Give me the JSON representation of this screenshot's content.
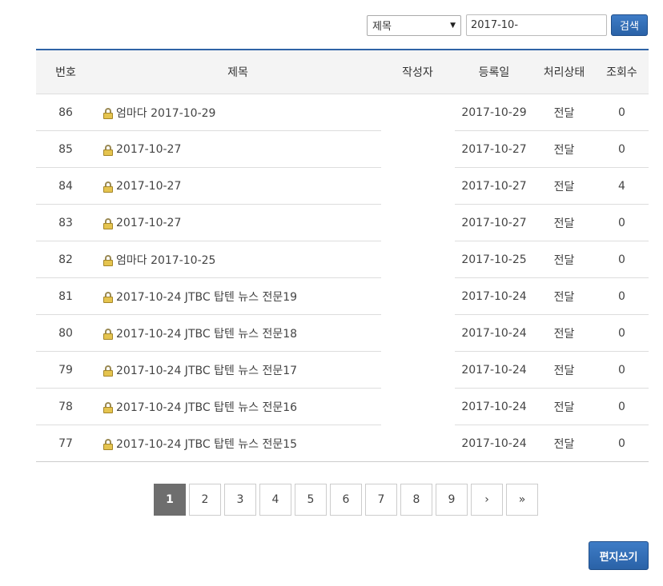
{
  "search": {
    "field_selected": "제목",
    "query_value": "2017-10-",
    "button_label": "검색"
  },
  "table": {
    "headers": {
      "number": "번호",
      "title": "제목",
      "author": "작성자",
      "date": "등록일",
      "status": "처리상태",
      "views": "조회수"
    },
    "rows": [
      {
        "number": "86",
        "title": "엄마다 2017-10-29",
        "author": "",
        "date": "2017-10-29",
        "status": "전달",
        "views": "0"
      },
      {
        "number": "85",
        "title": "2017-10-27",
        "author": "",
        "date": "2017-10-27",
        "status": "전달",
        "views": "0"
      },
      {
        "number": "84",
        "title": "2017-10-27",
        "author": "",
        "date": "2017-10-27",
        "status": "전달",
        "views": "4"
      },
      {
        "number": "83",
        "title": "2017-10-27",
        "author": "",
        "date": "2017-10-27",
        "status": "전달",
        "views": "0"
      },
      {
        "number": "82",
        "title": "엄마다 2017-10-25",
        "author": "",
        "date": "2017-10-25",
        "status": "전달",
        "views": "0"
      },
      {
        "number": "81",
        "title": "2017-10-24 JTBC 탑텐 뉴스 전문19",
        "author": "",
        "date": "2017-10-24",
        "status": "전달",
        "views": "0"
      },
      {
        "number": "80",
        "title": "2017-10-24 JTBC 탑텐 뉴스 전문18",
        "author": "",
        "date": "2017-10-24",
        "status": "전달",
        "views": "0"
      },
      {
        "number": "79",
        "title": "2017-10-24 JTBC 탑텐 뉴스 전문17",
        "author": "",
        "date": "2017-10-24",
        "status": "전달",
        "views": "0"
      },
      {
        "number": "78",
        "title": "2017-10-24 JTBC 탑텐 뉴스 전문16",
        "author": "",
        "date": "2017-10-24",
        "status": "전달",
        "views": "0"
      },
      {
        "number": "77",
        "title": "2017-10-24 JTBC 탑텐 뉴스 전문15",
        "author": "",
        "date": "2017-10-24",
        "status": "전달",
        "views": "0"
      }
    ]
  },
  "pagination": {
    "pages": [
      "1",
      "2",
      "3",
      "4",
      "5",
      "6",
      "7",
      "8",
      "9"
    ],
    "current": "1",
    "next_label": "›",
    "last_label": "»"
  },
  "actions": {
    "write_label": "편지쓰기"
  },
  "colors": {
    "accent": "#2f64a6",
    "button": "#2a62a7",
    "active_page": "#6e6e6e"
  }
}
